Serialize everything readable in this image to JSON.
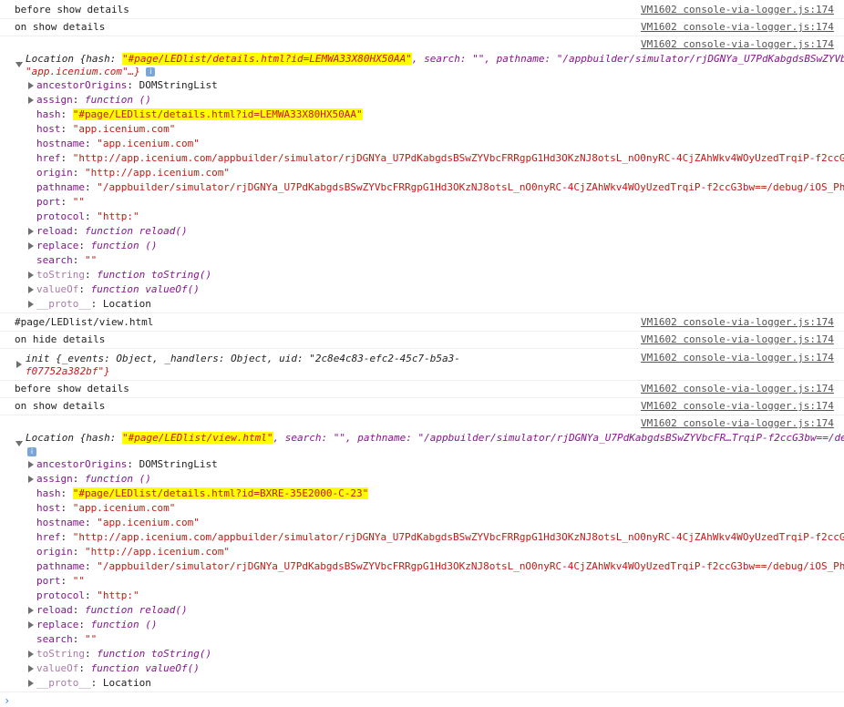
{
  "source_label": "VM1602 console-via-logger.js:174",
  "messages": {
    "m1": "before show details",
    "m2": "on show details",
    "m3": "#page/LEDlist/view.html",
    "m4": "on hide details",
    "m5": "before show details",
    "m6": "on show details"
  },
  "loc1": {
    "summary_prefix": "Location {hash: ",
    "hash_value": "\"#page/LEDlist/details.html?id=LEMWA33X80HX50AA\"",
    "summary_rest": ", search: \"\", pathname: \"/appbuilder/simulator/rjDGNYa_U7PdKabgdsBSwZYVb",
    "summary_line2": "\"app.icenium.com\"…}",
    "props": {
      "ancestorOrigins": "DOMStringList",
      "assign": "function ()",
      "hash": "\"#page/LEDlist/details.html?id=LEMWA33X80HX50AA\"",
      "host": "\"app.icenium.com\"",
      "hostname": "\"app.icenium.com\"",
      "href": "\"http://app.icenium.com/appbuilder/simulator/rjDGNYa_U7PdKabgdsBSwZYVbcFRRgpG1Hd3OKzNJ8otsL_nO0nyRC-4CjZAhWkv4WOyUzedTrqiP-f2ccG3",
      "origin": "\"http://app.icenium.com\"",
      "pathname": "\"/appbuilder/simulator/rjDGNYa_U7PdKabgdsBSwZYVbcFRRgpG1Hd3OKzNJ8otsL_nO0nyRC-4CjZAhWkv4WOyUzedTrqiP-f2ccG3bw==/debug/iOS_Pho",
      "port": "\"\"",
      "protocol": "\"http:\"",
      "reload": "function reload()",
      "replace": "function ()",
      "search": "\"\"",
      "toString": "function toString()",
      "valueOf": "function valueOf()",
      "proto": "Location"
    }
  },
  "init": {
    "line1": "init {_events: Object, _handlers: Object, uid: \"2c8e4c83-efc2-45c7-b5a3-",
    "line2": "f07752a382bf\"}"
  },
  "loc2": {
    "summary_prefix": "Location {hash: ",
    "hash_value": "\"#page/LEDlist/view.html\"",
    "summary_rest": ", search: \"\", pathname: \"/appbuilder/simulator/rjDGNYa_U7PdKabgdsBSwZYVbcFR…TrqiP-f2ccG3bw==/de",
    "props": {
      "ancestorOrigins": "DOMStringList",
      "assign": "function ()",
      "hash": "\"#page/LEDlist/details.html?id=BXRE-35E2000-C-23\"",
      "host": "\"app.icenium.com\"",
      "hostname": "\"app.icenium.com\"",
      "href": "\"http://app.icenium.com/appbuilder/simulator/rjDGNYa_U7PdKabgdsBSwZYVbcFRRgpG1Hd3OKzNJ8otsL_nO0nyRC-4CjZAhWkv4WOyUzedTrqiP-f2ccG3",
      "origin": "\"http://app.icenium.com\"",
      "pathname": "\"/appbuilder/simulator/rjDGNYa_U7PdKabgdsBSwZYVbcFRRgpG1Hd3OKzNJ8otsL_nO0nyRC-4CjZAhWkv4WOyUzedTrqiP-f2ccG3bw==/debug/iOS_Pho",
      "port": "\"\"",
      "protocol": "\"http:\"",
      "reload": "function reload()",
      "replace": "function ()",
      "search": "\"\"",
      "toString": "function toString()",
      "valueOf": "function valueOf()",
      "proto": "Location"
    }
  },
  "keys": {
    "ancestorOrigins": "ancestorOrigins",
    "assign": "assign",
    "hash": "hash",
    "host": "host",
    "hostname": "hostname",
    "href": "href",
    "origin": "origin",
    "pathname": "pathname",
    "port": "port",
    "protocol": "protocol",
    "reload": "reload",
    "replace": "replace",
    "search": "search",
    "toString": "toString",
    "valueOf": "valueOf",
    "proto": "__proto__"
  },
  "prompt_glyph": "›",
  "info_glyph": "i",
  "colors": {
    "highlight": "#ffff00",
    "string": "#c41a16",
    "key": "#881391",
    "link": "#545454"
  }
}
